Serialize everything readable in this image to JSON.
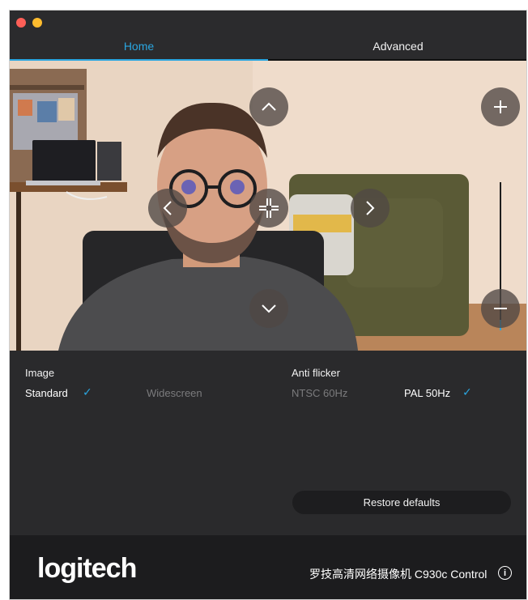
{
  "tabs": {
    "home": "Home",
    "advanced": "Advanced"
  },
  "accent_color": "#2aa6e0",
  "preview": {
    "controls": {
      "pan_up": "chevron-up-icon",
      "pan_down": "chevron-down-icon",
      "pan_left": "chevron-left-icon",
      "pan_right": "chevron-right-icon",
      "center": "crosshair-icon",
      "zoom_in": "plus-icon",
      "zoom_out": "minus-icon"
    },
    "zoom_level_fraction": 0.07
  },
  "image": {
    "label": "Image",
    "standard": "Standard",
    "widescreen": "Widescreen",
    "selected": "Standard"
  },
  "anti_flicker": {
    "label": "Anti flicker",
    "ntsc": "NTSC 60Hz",
    "pal": "PAL 50Hz",
    "selected": "PAL 50Hz"
  },
  "check_glyph": "✓",
  "restore_label": "Restore defaults",
  "footer": {
    "logo": "logitech",
    "product_name": "罗技高清网络摄像机 C930c Control",
    "info_glyph": "i"
  }
}
